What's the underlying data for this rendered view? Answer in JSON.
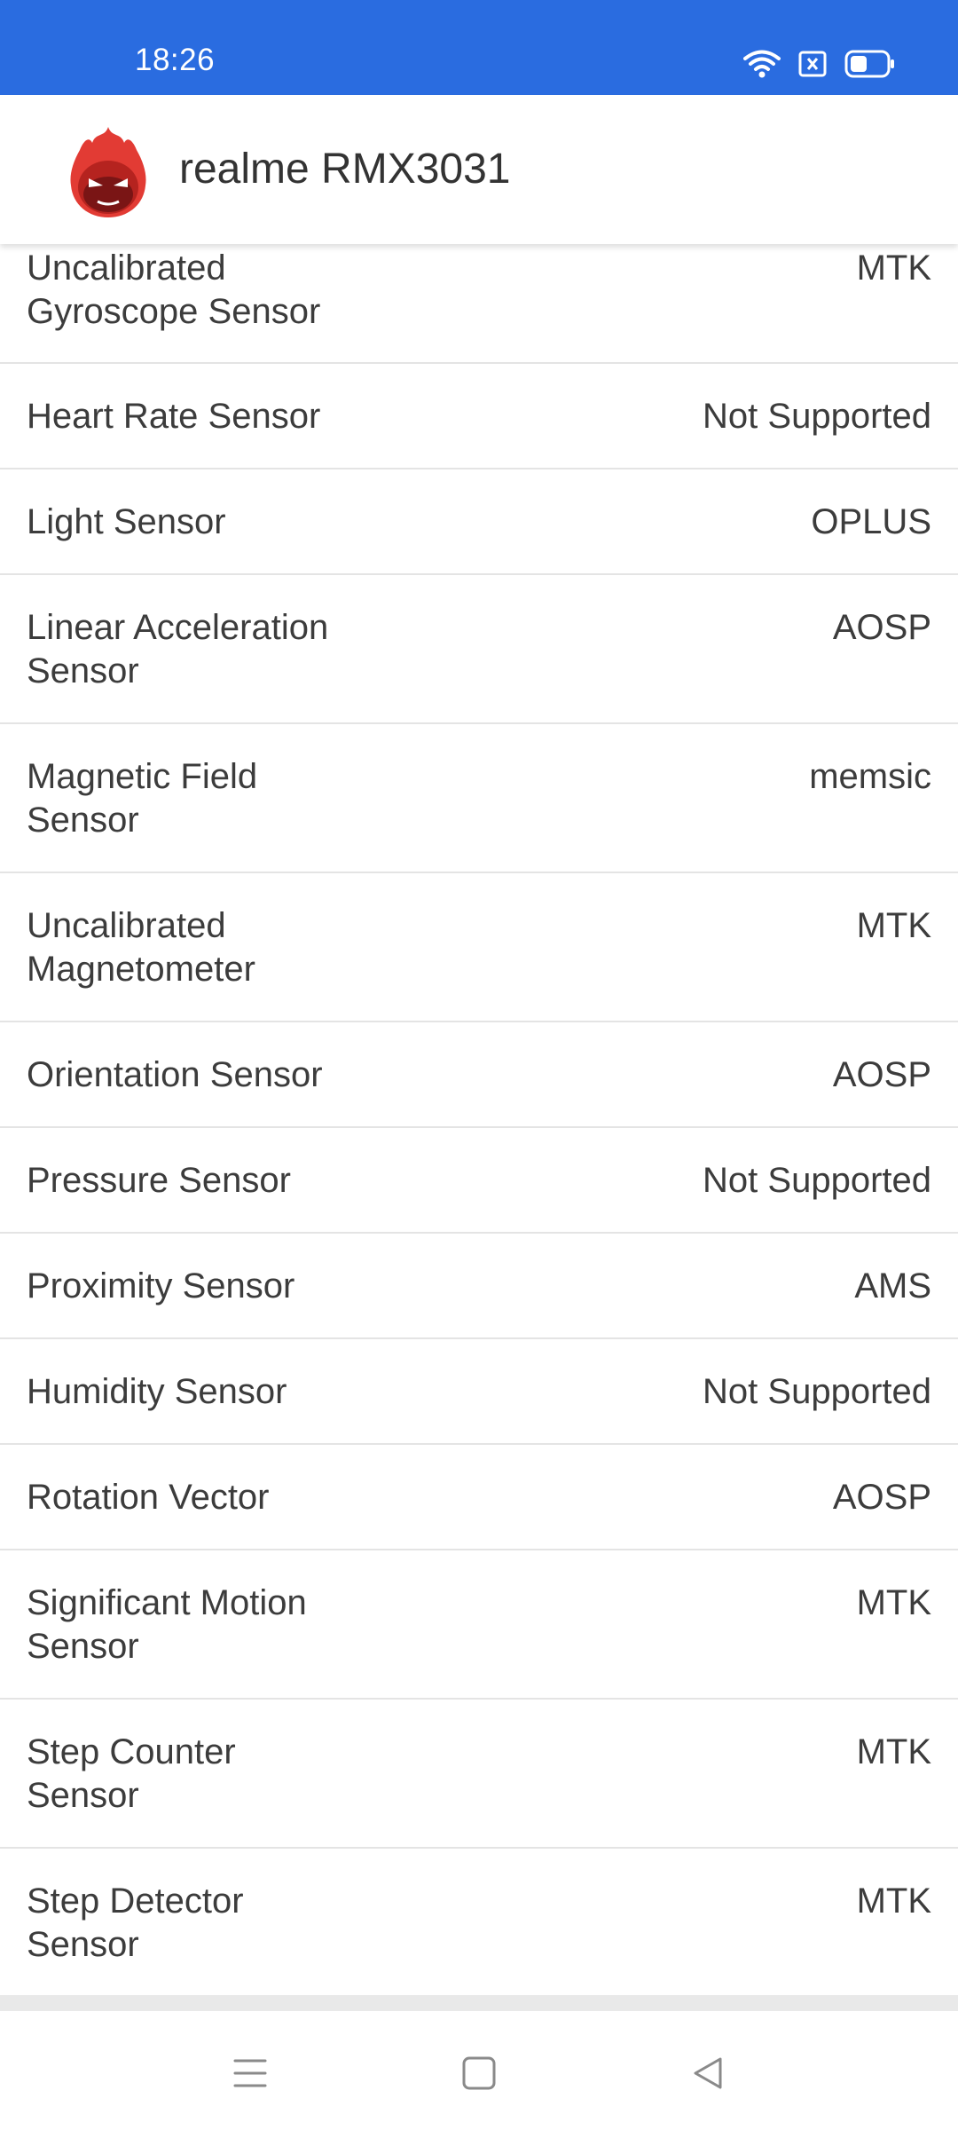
{
  "status_bar": {
    "time": "18:26",
    "icons": [
      "wifi-icon",
      "sim-x-icon",
      "battery-icon"
    ],
    "color": "#2a6ce0"
  },
  "app_bar": {
    "title": "realme RMX3031",
    "logo_icon": "antutu-logo-icon"
  },
  "sensors": [
    {
      "label_line1": "Uncalibrated",
      "label_line2": "Gyroscope Sensor",
      "value": "MTK"
    },
    {
      "label_line1": "Heart Rate Sensor",
      "label_line2": "",
      "value": "Not Supported"
    },
    {
      "label_line1": "Light Sensor",
      "label_line2": "",
      "value": "OPLUS"
    },
    {
      "label_line1": "Linear Acceleration",
      "label_line2": "Sensor",
      "value": "AOSP"
    },
    {
      "label_line1": "Magnetic Field",
      "label_line2": "Sensor",
      "value": "memsic"
    },
    {
      "label_line1": "Uncalibrated",
      "label_line2": "Magnetometer",
      "value": "MTK"
    },
    {
      "label_line1": "Orientation Sensor",
      "label_line2": "",
      "value": "AOSP"
    },
    {
      "label_line1": "Pressure Sensor",
      "label_line2": "",
      "value": "Not Supported"
    },
    {
      "label_line1": "Proximity Sensor",
      "label_line2": "",
      "value": "AMS"
    },
    {
      "label_line1": "Humidity Sensor",
      "label_line2": "",
      "value": "Not Supported"
    },
    {
      "label_line1": "Rotation Vector",
      "label_line2": "",
      "value": "AOSP"
    },
    {
      "label_line1": "Significant Motion",
      "label_line2": "Sensor",
      "value": "MTK"
    },
    {
      "label_line1": "Step Counter",
      "label_line2": "Sensor",
      "value": "MTK"
    },
    {
      "label_line1": "Step Detector",
      "label_line2": "Sensor",
      "value": "MTK"
    }
  ],
  "nav_bar": {
    "icons": [
      "menu-icon",
      "home-icon",
      "back-icon"
    ]
  }
}
